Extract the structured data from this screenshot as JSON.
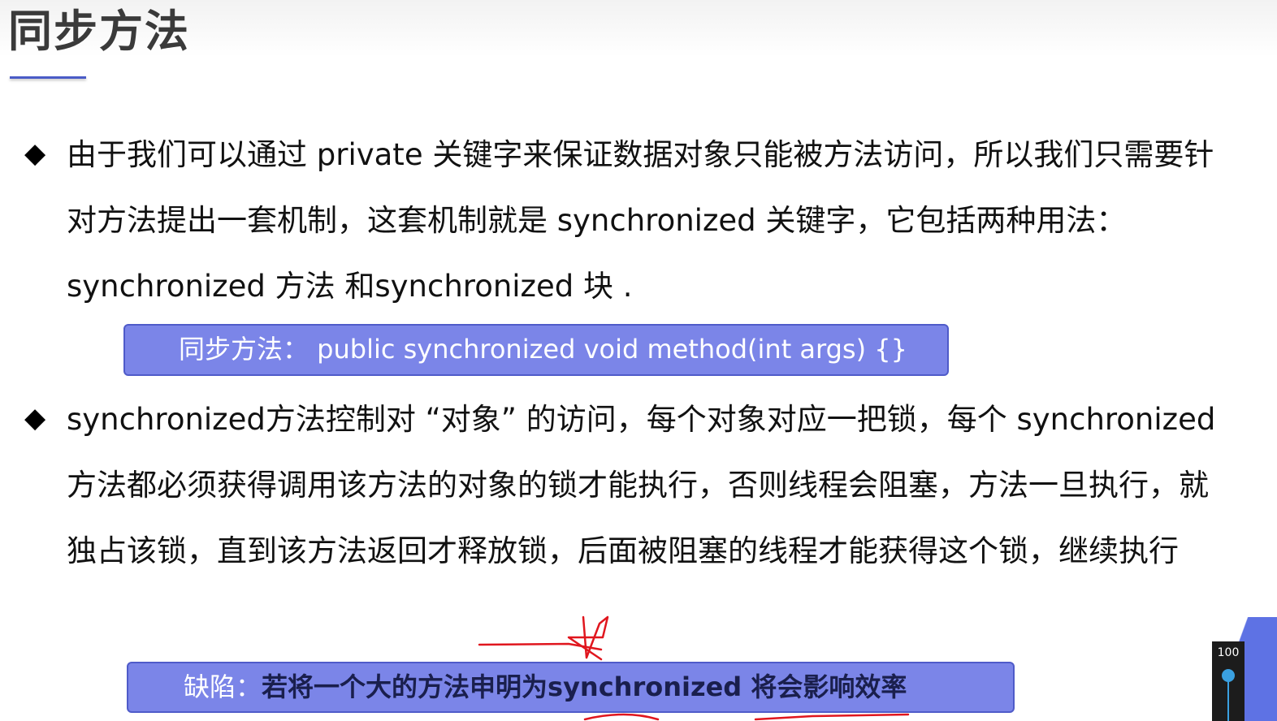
{
  "slide": {
    "title": "同步方法",
    "bullet_glyph": "◆",
    "bullet1": {
      "text": "由于我们可以通过 private 关键字来保证数据对象只能被方法访问，所以我们只需要针对方法提出一套机制，这套机制就是 synchronized 关键字，它包括两种用法：synchronized 方法 和synchronized 块 ."
    },
    "code_box": {
      "text": "同步方法：  public synchronized void method(int args) {}"
    },
    "bullet2": {
      "text": "synchronized方法控制对 “对象” 的访问，每个对象对应一把锁，每个 synchronized方法都必须获得调用该方法的对象的锁才能执行，否则线程会阻塞，方法一旦执行，就独占该锁，直到该方法返回才释放锁，后面被阻塞的线程才能获得这个锁，继续执行"
    },
    "defect_box": {
      "label": "缺陷：",
      "text": "若将一个大的方法申明为synchronized 将会影响效率"
    }
  },
  "zoom": {
    "value": "100"
  },
  "colors": {
    "accent": "#7b85e8",
    "accent_border": "#4f5bc9",
    "underline": "#4a5bc7",
    "annotation": "#e0161e",
    "zoom_track": "#3aa0e0"
  },
  "icons": {
    "bullet": "diamond-bullet-icon",
    "zoom_thumb": "slider-thumb-icon"
  }
}
